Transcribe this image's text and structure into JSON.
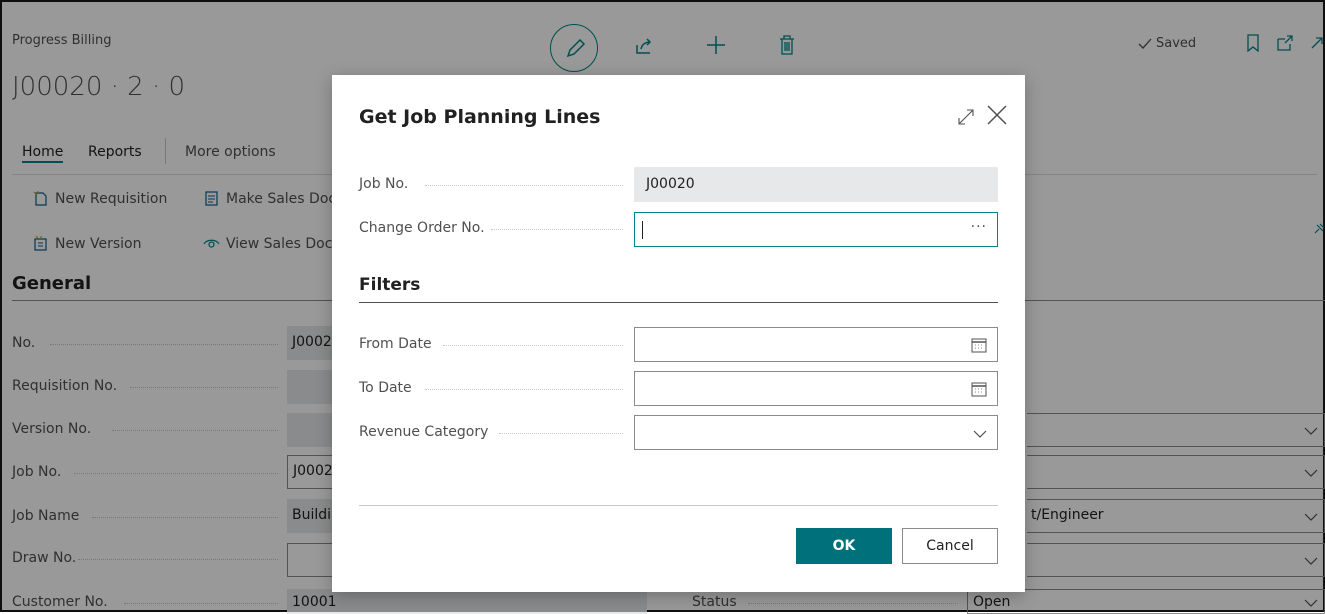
{
  "page": {
    "caption": "Progress Billing",
    "title": "J00020 · 2 · 0",
    "saved": "Saved",
    "tabs": {
      "home": "Home",
      "reports": "Reports",
      "more": "More options"
    },
    "actions": {
      "new_requisition": "New Requisition",
      "make_sales_doc": "Make Sales Doc",
      "new_version": "New Version",
      "view_sales_doc": "View Sales Doc"
    },
    "section": "General",
    "fields": {
      "no_label": "No.",
      "no_value": "J0002",
      "req_label": "Requisition No.",
      "version_label": "Version No.",
      "job_label": "Job No.",
      "job_value": "J0002",
      "jobname_label": "Job Name",
      "jobname_value": "Buildi",
      "draw_label": "Draw No.",
      "customer_label": "Customer No.",
      "customer_value": "10001",
      "status_label": "Status",
      "status_value": "Open",
      "engineer_value": "t/Engineer"
    }
  },
  "dialog": {
    "title": "Get Job Planning Lines",
    "job_no_label": "Job No.",
    "job_no_value": "J00020",
    "change_order_label": "Change Order No.",
    "change_order_value": "",
    "filters_heading": "Filters",
    "from_date_label": "From Date",
    "to_date_label": "To Date",
    "revenue_category_label": "Revenue Category",
    "ok_label": "OK",
    "cancel_label": "Cancel",
    "ellipsis": "···"
  },
  "colors": {
    "accent": "#008489",
    "teal_dark": "#00707a",
    "overlay": "rgba(0,0,0,0.40)"
  }
}
